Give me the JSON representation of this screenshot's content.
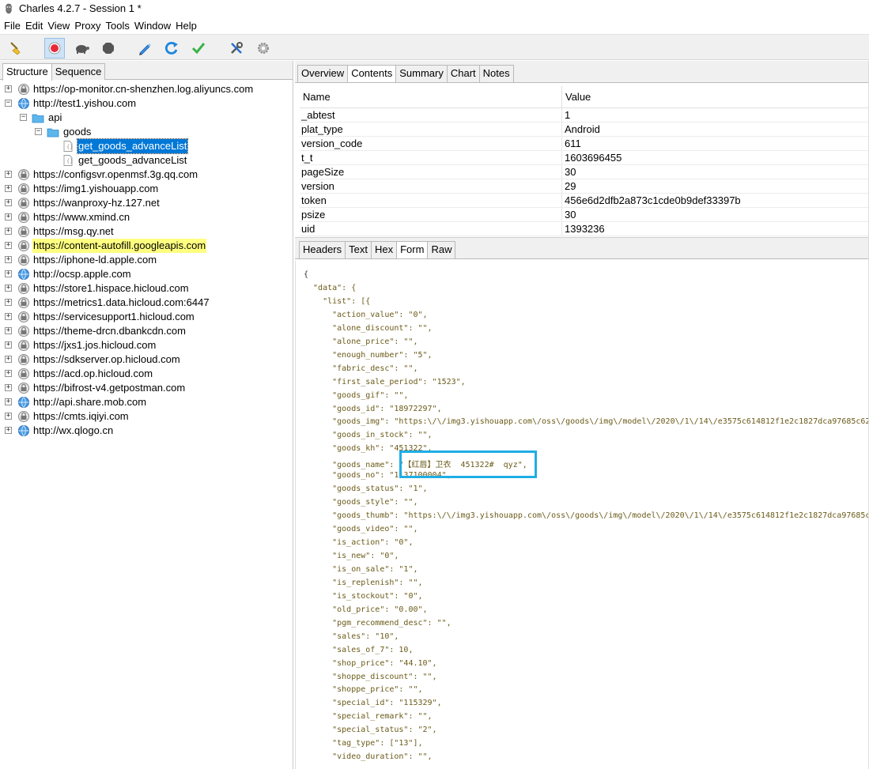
{
  "window": {
    "title": "Charles 4.2.7 - Session 1 *"
  },
  "menu": [
    "File",
    "Edit",
    "View",
    "Proxy",
    "Tools",
    "Window",
    "Help"
  ],
  "toolbar": {
    "buttons": [
      "broom-icon",
      "record-icon",
      "turtle-icon",
      "stop-hexagon-icon",
      "pen-icon",
      "refresh-icon",
      "check-icon",
      "tools-icon",
      "gear-icon"
    ]
  },
  "left_tabs": [
    "Structure",
    "Sequence"
  ],
  "tree": [
    {
      "label": "https://op-monitor.cn-shenzhen.log.aliyuncs.com",
      "level": 0,
      "expander": "+",
      "icon": "lock-globe"
    },
    {
      "label": "http://test1.yishou.com",
      "level": 0,
      "expander": "−",
      "icon": "globe"
    },
    {
      "label": "api",
      "level": 1,
      "expander": "−",
      "icon": "folder"
    },
    {
      "label": "goods",
      "level": 2,
      "expander": "−",
      "icon": "folder"
    },
    {
      "label": "get_goods_advanceList",
      "level": 3,
      "expander": "",
      "icon": "file",
      "selected": true
    },
    {
      "label": "get_goods_advanceList",
      "level": 3,
      "expander": "",
      "icon": "file"
    },
    {
      "label": "https://configsvr.openmsf.3g.qq.com",
      "level": 0,
      "expander": "+",
      "icon": "lock-globe"
    },
    {
      "label": "https://img1.yishouapp.com",
      "level": 0,
      "expander": "+",
      "icon": "lock-globe"
    },
    {
      "label": "https://wanproxy-hz.127.net",
      "level": 0,
      "expander": "+",
      "icon": "lock-globe"
    },
    {
      "label": "https://www.xmind.cn",
      "level": 0,
      "expander": "+",
      "icon": "lock-globe"
    },
    {
      "label": "https://msg.qy.net",
      "level": 0,
      "expander": "+",
      "icon": "lock-globe"
    },
    {
      "label": "https://content-autofill.googleapis.com",
      "level": 0,
      "expander": "+",
      "icon": "lock-globe",
      "highlight": true
    },
    {
      "label": "https://iphone-ld.apple.com",
      "level": 0,
      "expander": "+",
      "icon": "lock-globe"
    },
    {
      "label": "http://ocsp.apple.com",
      "level": 0,
      "expander": "+",
      "icon": "globe"
    },
    {
      "label": "https://store1.hispace.hicloud.com",
      "level": 0,
      "expander": "+",
      "icon": "lock-globe"
    },
    {
      "label": "https://metrics1.data.hicloud.com:6447",
      "level": 0,
      "expander": "+",
      "icon": "lock-globe"
    },
    {
      "label": "https://servicesupport1.hicloud.com",
      "level": 0,
      "expander": "+",
      "icon": "lock-globe"
    },
    {
      "label": "https://theme-drcn.dbankcdn.com",
      "level": 0,
      "expander": "+",
      "icon": "lock-globe"
    },
    {
      "label": "https://jxs1.jos.hicloud.com",
      "level": 0,
      "expander": "+",
      "icon": "lock-globe"
    },
    {
      "label": "https://sdkserver.op.hicloud.com",
      "level": 0,
      "expander": "+",
      "icon": "lock-globe"
    },
    {
      "label": "https://acd.op.hicloud.com",
      "level": 0,
      "expander": "+",
      "icon": "lock-globe"
    },
    {
      "label": "https://bifrost-v4.getpostman.com",
      "level": 0,
      "expander": "+",
      "icon": "lock-globe"
    },
    {
      "label": "http://api.share.mob.com",
      "level": 0,
      "expander": "+",
      "icon": "globe"
    },
    {
      "label": "https://cmts.iqiyi.com",
      "level": 0,
      "expander": "+",
      "icon": "lock-globe"
    },
    {
      "label": "http://wx.qlogo.cn",
      "level": 0,
      "expander": "+",
      "icon": "globe"
    }
  ],
  "right_tabs": [
    "Overview",
    "Contents",
    "Summary",
    "Chart",
    "Notes"
  ],
  "params": {
    "header_name": "Name",
    "header_value": "Value",
    "rows": [
      {
        "name": "_abtest",
        "value": "1"
      },
      {
        "name": "plat_type",
        "value": "Android"
      },
      {
        "name": "version_code",
        "value": "611"
      },
      {
        "name": "t_t",
        "value": "1603696455"
      },
      {
        "name": "pageSize",
        "value": "30"
      },
      {
        "name": "version",
        "value": "29"
      },
      {
        "name": "token",
        "value": "456e6d2dfb2a873c1cde0b9def33397b"
      },
      {
        "name": "psize",
        "value": "30"
      },
      {
        "name": "uid",
        "value": "1393236"
      }
    ]
  },
  "sub_tabs": [
    "Headers",
    "Text",
    "Hex",
    "Form",
    "Raw"
  ],
  "json_lines": [
    "{",
    "  \"data\": {",
    "    \"list\": [{",
    "      \"action_value\": \"0\",",
    "      \"alone_discount\": \"\",",
    "      \"alone_price\": \"\",",
    "      \"enough_number\": \"5\",",
    "      \"fabric_desc\": \"\",",
    "      \"first_sale_period\": \"1523\",",
    "      \"goods_gif\": \"\",",
    "      \"goods_id\": \"18972297\",",
    "      \"goods_img\": \"https:\\/\\/img3.yishouapp.com\\/oss\\/goods\\/img\\/model\\/2020\\/1\\/14\\/e3575c614812f1e2c1827dca97685c62.",
    "      \"goods_in_stock\": \"\",",
    "      \"goods_kh\": \"451322\",",
    "      \"goods_name\": \"【红唇】卫衣  451322#  qyz\",",
    "      \"goods_no\": \"1137100004\",",
    "      \"goods_status\": \"1\",",
    "      \"goods_style\": \"\",",
    "      \"goods_thumb\": \"https:\\/\\/img3.yishouapp.com\\/oss\\/goods\\/img\\/model\\/2020\\/1\\/14\\/e3575c614812f1e2c1827dca97685c6",
    "      \"goods_video\": \"\",",
    "      \"is_action\": \"0\",",
    "      \"is_new\": \"0\",",
    "      \"is_on_sale\": \"1\",",
    "      \"is_replenish\": \"\",",
    "      \"is_stockout\": \"0\",",
    "      \"old_price\": \"0.00\",",
    "      \"pgm_recommend_desc\": \"\",",
    "      \"sales\": \"10\",",
    "      \"sales_of_7\": 10,",
    "      \"shop_price\": \"44.10\",",
    "      \"shoppe_discount\": \"\",",
    "      \"shoppe_price\": \"\",",
    "      \"special_id\": \"115329\",",
    "      \"special_remark\": \"\",",
    "      \"special_status\": \"2\",",
    "      \"tag_type\": [\"13\"],",
    "      \"video_duration\": \"\","
  ]
}
